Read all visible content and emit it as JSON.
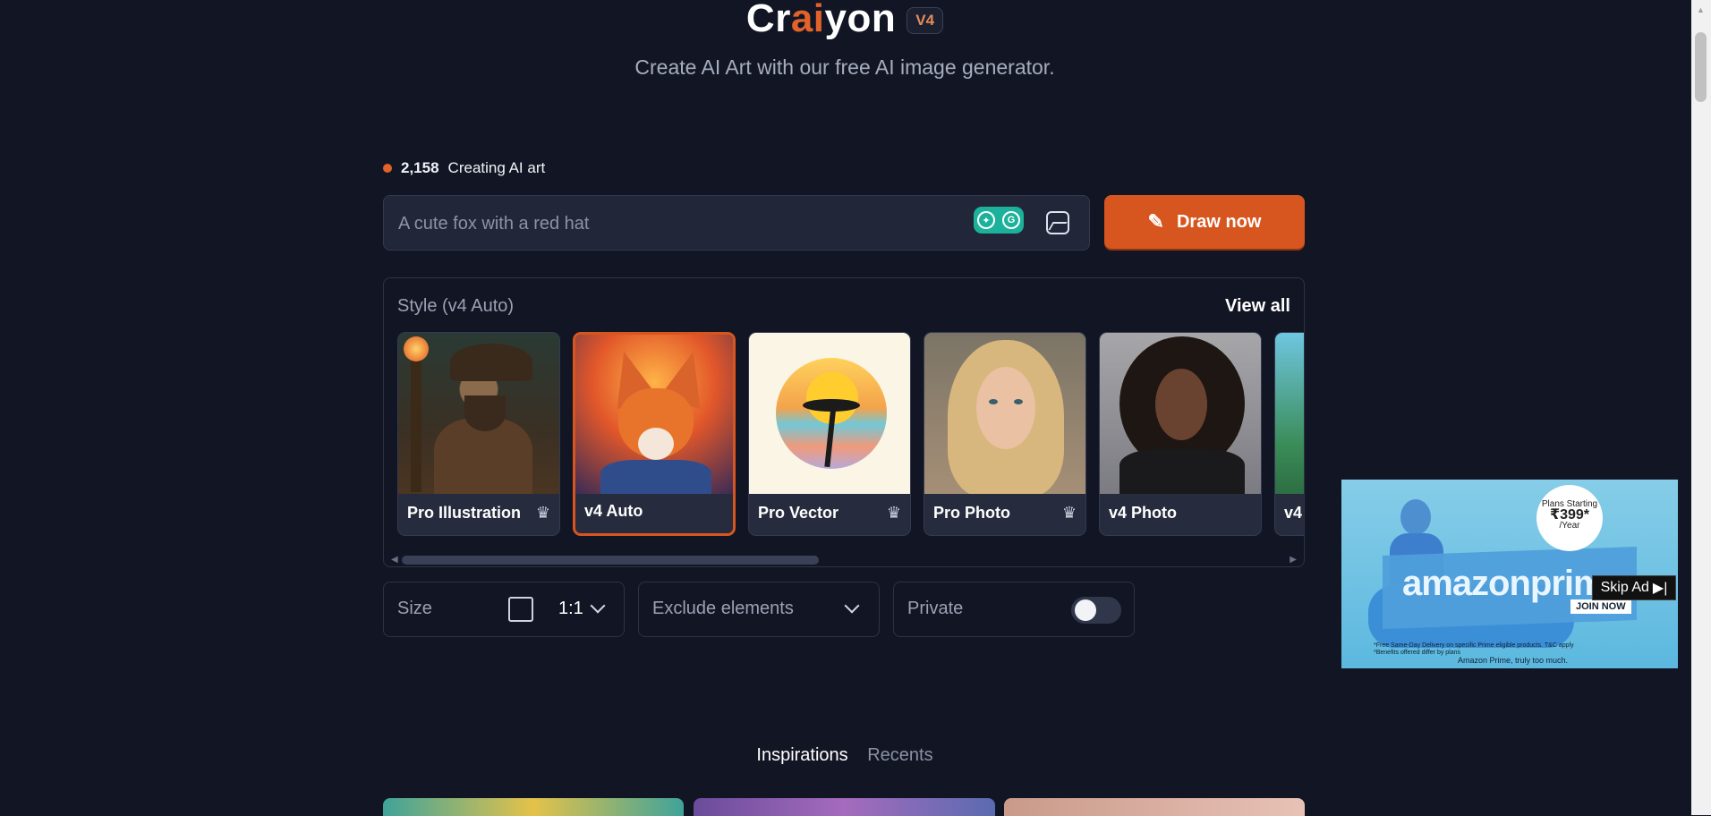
{
  "header": {
    "logo_parts": [
      "Cr",
      "ai",
      "yon"
    ],
    "version_badge": "V4",
    "tagline": "Create AI Art with our free AI image generator."
  },
  "status": {
    "count": "2,158",
    "label": "Creating AI art"
  },
  "prompt": {
    "placeholder": "A cute fox with a red hat",
    "value": "",
    "extension_icons": [
      "lightbulb-icon",
      "grammarly-icon"
    ],
    "upload_icon": "image-upload-icon",
    "draw_button": "Draw now",
    "draw_icon": "pencil-icon"
  },
  "styles": {
    "title": "Style (v4 Auto)",
    "view_all": "View all",
    "selected": "v4 Auto",
    "cards": [
      {
        "label": "Pro Illustration",
        "premium": true
      },
      {
        "label": "v4 Auto",
        "premium": false
      },
      {
        "label": "Pro Vector",
        "premium": true
      },
      {
        "label": "Pro Photo",
        "premium": true
      },
      {
        "label": "v4 Photo",
        "premium": false
      },
      {
        "label": "v4",
        "premium": false
      }
    ]
  },
  "options": {
    "size_label": "Size",
    "size_value": "1:1",
    "exclude_label": "Exclude elements",
    "private_label": "Private",
    "private_on": false
  },
  "tabs": {
    "inspirations": "Inspirations",
    "recents": "Recents",
    "active": "Inspirations"
  },
  "ad": {
    "cloud_line1": "Plans Starting",
    "cloud_price": "₹399*",
    "cloud_line3": "/Year",
    "brand": "amazonprime",
    "join": "JOIN NOW",
    "fine_print": "*Free Same-Day Delivery on specific Prime eligible products. T&C apply *Benefits offered differ by plans",
    "slogan": "Amazon Prime, truly too much.",
    "skip_label": "Skip Ad"
  },
  "colors": {
    "background": "#121624",
    "accent": "#d7561f",
    "panel": "#212638"
  }
}
